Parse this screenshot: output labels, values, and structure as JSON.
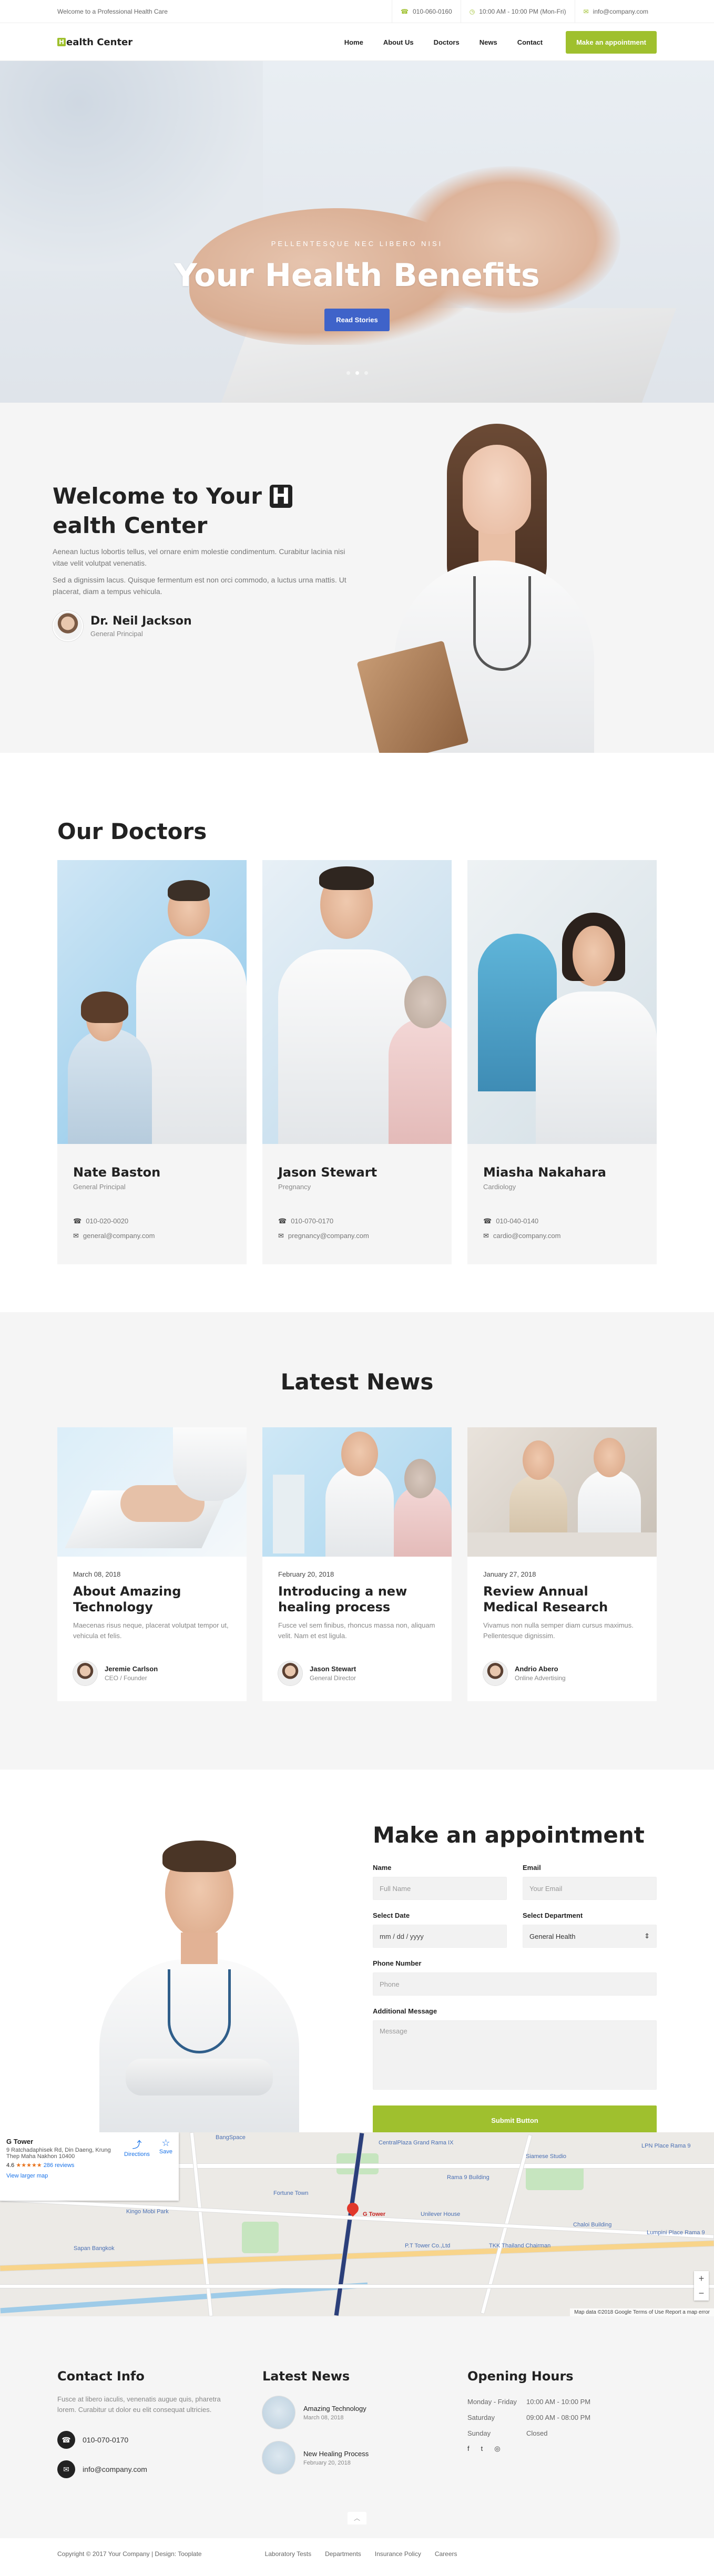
{
  "topbar": {
    "welcome": "Welcome to a Professional Health Care",
    "phone": "010-060-0160",
    "hours": "10:00 AM - 10:00 PM (Mon-Fri)",
    "email": "info@company.com"
  },
  "header": {
    "logo_letter": "H",
    "logo_rest": "ealth Center",
    "nav": [
      "Home",
      "About Us",
      "Doctors",
      "News",
      "Contact"
    ],
    "cta": "Make an appointment"
  },
  "hero": {
    "subtitle": "PELLENTESQUE NEC LIBERO NISI",
    "title": "Your Health Benefits",
    "button": "Read Stories"
  },
  "welcome": {
    "title_1": "Welcome to Your ",
    "title_h": "H",
    "title_2": "ealth Center",
    "p1": "Aenean luctus lobortis tellus, vel ornare enim molestie condimentum. Curabitur lacinia nisi vitae velit volutpat venenatis.",
    "p2": "Sed a dignissim lacus. Quisque fermentum est non orci commodo, a luctus urna mattis. Ut placerat, diam a tempus vehicula.",
    "name": "Dr. Neil Jackson",
    "role": "General Principal"
  },
  "doctors": {
    "title": "Our Doctors",
    "items": [
      {
        "name": "Nate Baston",
        "role": "General Principal",
        "phone": "010-020-0020",
        "email": "general@company.com"
      },
      {
        "name": "Jason Stewart",
        "role": "Pregnancy",
        "phone": "010-070-0170",
        "email": "pregnancy@company.com"
      },
      {
        "name": "Miasha Nakahara",
        "role": "Cardiology",
        "phone": "010-040-0140",
        "email": "cardio@company.com"
      }
    ]
  },
  "news": {
    "title": "Latest News",
    "items": [
      {
        "date": "March 08, 2018",
        "title": "About Amazing Technology",
        "text": "Maecenas risus neque, placerat volutpat tempor ut, vehicula et felis.",
        "author": "Jeremie Carlson",
        "role": "CEO / Founder"
      },
      {
        "date": "February 20, 2018",
        "title": "Introducing a new healing process",
        "text": "Fusce vel sem finibus, rhoncus massa non, aliquam velit. Nam et est ligula.",
        "author": "Jason Stewart",
        "role": "General Director"
      },
      {
        "date": "January 27, 2018",
        "title": "Review Annual Medical Research",
        "text": "Vivamus non nulla semper diam cursus maximus. Pellentesque dignissim.",
        "author": "Andrio Abero",
        "role": "Online Advertising"
      }
    ]
  },
  "appointment": {
    "title": "Make an appointment",
    "name_label": "Name",
    "name_ph": "Full Name",
    "email_label": "Email",
    "email_ph": "Your Email",
    "date_label": "Select Date",
    "date_ph": "mm / dd / yyyy",
    "dept_label": "Select Department",
    "dept_value": "General Health",
    "phone_label": "Phone Number",
    "phone_ph": "Phone",
    "msg_label": "Additional Message",
    "msg_ph": "Message",
    "submit": "Submit Button"
  },
  "map": {
    "place": "G Tower",
    "address": "9 Ratchadaphisek Rd, Din Daeng, Krung Thep Maha Nakhon 10400",
    "rating": "4.6",
    "stars": "★★★★★",
    "reviews": "286 reviews",
    "larger": "View larger map",
    "directions": "Directions",
    "save": "Save",
    "labels": [
      "BangSpace",
      "CentralPlaza Grand Rama IX",
      "Siamese Studio",
      "LPN Place Rama 9",
      "Rama 9 Building",
      "Fortune Town",
      "Unilever House",
      "Kingo Mobi Park",
      "Sapan Bangkok",
      "TKK Thailand Chairman",
      "P.T Tower Co.,Ltd",
      "Chaloi Building",
      "Lumpini Place Rama 9"
    ],
    "footer": "Map data ©2018 Google   Terms of Use   Report a map error"
  },
  "footer": {
    "contact_title": "Contact Info",
    "contact_text": "Fusce at libero iaculis, venenatis augue quis, pharetra lorem. Curabitur ut dolor eu elit consequat ultricies.",
    "phone": "010-070-0170",
    "email": "info@company.com",
    "news_title": "Latest News",
    "news": [
      {
        "title": "Amazing Technology",
        "date": "March 08, 2018"
      },
      {
        "title": "New Healing Process",
        "date": "February 20, 2018"
      }
    ],
    "hours_title": "Opening Hours",
    "hours": [
      {
        "day": "Monday - Friday",
        "time": "10:00 AM - 10:00 PM"
      },
      {
        "day": "Saturday",
        "time": "09:00 AM - 08:00 PM"
      },
      {
        "day": "Sunday",
        "time": "Closed"
      }
    ],
    "social": [
      "f",
      "t",
      "◎"
    ],
    "copyright": "Copyright © 2017 Your Company | Design: Tooplate",
    "links": [
      "Laboratory Tests",
      "Departments",
      "Insurance Policy",
      "Careers"
    ]
  },
  "colors": {
    "accent": "#9fc02e",
    "blue_button": "#3f63c9"
  }
}
